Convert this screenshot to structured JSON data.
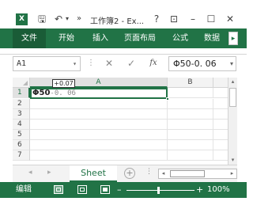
{
  "window": {
    "title": "工作簿2 - Ex...",
    "logo_letter": "X",
    "help": "?",
    "ribbon_display": "⊡",
    "minimize": "–",
    "maximize": "☐",
    "close": "✕"
  },
  "qat": {
    "save_icon": "🖫",
    "undo_icon": "↶",
    "undo_dropdown": "▾",
    "customize": "»"
  },
  "ribbon": {
    "file_tab": "文件",
    "tabs": [
      "开始",
      "插入",
      "页面布局",
      "公式",
      "数据"
    ],
    "scroll_right": "▸"
  },
  "formula_bar": {
    "name_box": "A1",
    "name_box_arrow": "▾",
    "separator": "⋮",
    "cancel": "✕",
    "enter": "✓",
    "fx": "fx",
    "content": "Φ50-0. 06",
    "expand_arrow": "▾"
  },
  "grid": {
    "columns": [
      "A",
      "B",
      "C"
    ],
    "rows": [
      "1",
      "2",
      "3",
      "4",
      "5",
      "6",
      "7"
    ],
    "active_cell": {
      "main": "Φ50",
      "tolerance": "-0. 06",
      "superscript_box": "+0.07"
    }
  },
  "sheet_tabs": {
    "prev": "◂",
    "next": "▸",
    "active_sheet": "Sheet",
    "add": "+",
    "dots": "⋮"
  },
  "scrollbars": {
    "up": "▴",
    "down": "▾",
    "left": "◂",
    "right": "▸"
  },
  "status_bar": {
    "mode": "编辑",
    "zoom_minus": "–",
    "zoom_plus": "+",
    "zoom": "100%"
  },
  "colors": {
    "accent": "#217346"
  }
}
